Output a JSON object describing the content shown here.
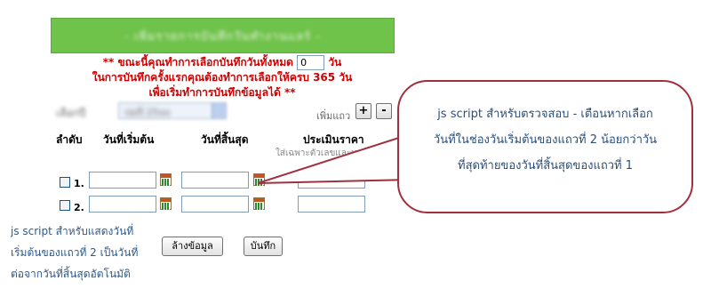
{
  "banner": {
    "title": "- เพิ่มรายการบันทึกวันทำงานแลร์ -"
  },
  "notice": {
    "line1_prefix": "** ขณะนี้คุณทำการเลือกบันทึกวันทั้งหมด",
    "count_value": "0",
    "line1_suffix": "วัน",
    "line2": "ในการบันทึกครั้งแรกคุณต้องทำการเลือกให้ครบ 365 วัน",
    "line3": "เพื่อเริ่มทำการบันทึกข้อมูลได้ **"
  },
  "filter": {
    "label": "เลือกปี",
    "select_value": "บ่มปี 25xx"
  },
  "add_row": {
    "label": "เพิ่มแถว",
    "plus": "+",
    "minus": "-"
  },
  "columns": {
    "order": "ลำดับ",
    "start_date": "วันที่เริ่มต้น",
    "end_date": "วันที่สิ้นสุด",
    "estimate": "ประเมินราคา",
    "estimate_hint": "ใส่เฉพาะตัวเลขและทศนิยม"
  },
  "rows": [
    {
      "num": "1.",
      "start": "",
      "end": "",
      "estimate": ""
    },
    {
      "num": "2.",
      "start": "",
      "end": "",
      "estimate": ""
    }
  ],
  "buttons": {
    "clear": "ล้างข้อมูล",
    "save": "บันทึก"
  },
  "left_note": {
    "line1": "js script สำหรับแสดงวันที่",
    "line2": "เริ่มต้นของแถวที่ 2 เป็นวันที่",
    "line3": "ต่อจากวันที่สิ้นสุดอัตโนมัติ"
  },
  "bubble_note": {
    "line1": "js script สำหรับตรวจสอบ - เตือนหากเลือก",
    "line2": "วันที่ในช่องวันเริ่มต้นของแถวที่ 2 น้อยกว่าวัน",
    "line3": "ที่สุดท้ายของวันที่สิ้นสุดของแถวที่ 1"
  },
  "colors": {
    "banner": "#6fc24a",
    "notice": "#d00000",
    "note_text": "#2a5b8e",
    "bubble_border": "#a0303f"
  },
  "icons": {
    "calendar": "calendar-icon"
  }
}
